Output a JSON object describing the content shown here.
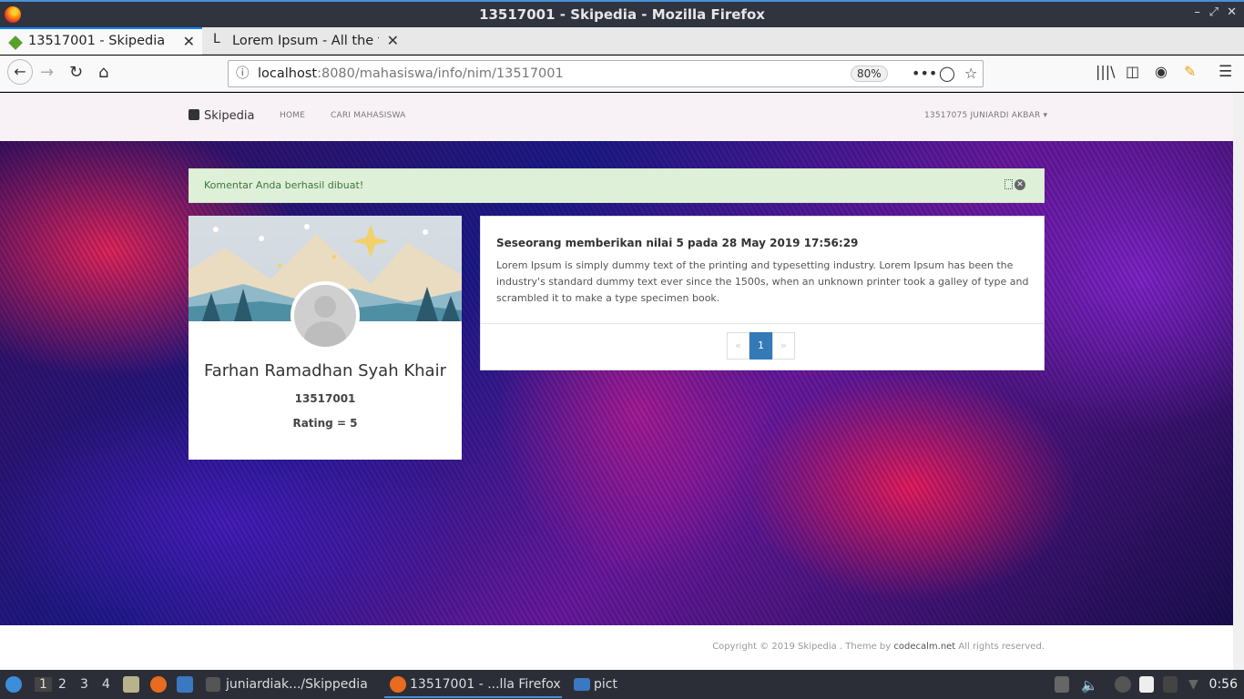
{
  "window": {
    "title": "13517001 - Skipedia - Mozilla Firefox"
  },
  "tabs": [
    {
      "label": "13517001 - Skipedia",
      "active": true
    },
    {
      "label": "Lorem Ipsum - All the facts - Lipsum generator",
      "active": false
    }
  ],
  "urlbar": {
    "host": "localhost",
    "path": ":8080/mahasiswa/info/nim/13517001",
    "zoom": "80%"
  },
  "site": {
    "brand": "Skipedia",
    "nav": [
      "HOME",
      "CARI MAHASISWA"
    ],
    "user": "13517075 JUNIARDI AKBAR"
  },
  "alert": {
    "text": "Komentar Anda berhasil dibuat!"
  },
  "profile": {
    "name": "Farhan Ramadhan Syah Khair",
    "nim": "13517001",
    "rating": "Rating = 5"
  },
  "review": {
    "title": "Seseorang memberikan nilai 5 pada 28 May 2019 17:56:29",
    "body": "Lorem Ipsum is simply dummy text of the printing and typesetting industry. Lorem Ipsum has been the industry's standard dummy text ever since the 1500s, when an unknown printer took a galley of type and scrambled it to make a type specimen book."
  },
  "pagination": {
    "prev": "«",
    "current": "1",
    "next": "»"
  },
  "footer": {
    "prefix": "Copyright © 2019 Skipedia . Theme by ",
    "link": "codecalm.net",
    "suffix": " All rights reserved."
  },
  "taskbar": {
    "workspaces": [
      "1",
      "2",
      "3",
      "4"
    ],
    "terminal": "juniardiak.../Skippedia",
    "firefox": "13517001 - ...lla Firefox",
    "folder": "pict",
    "clock": "0:56"
  }
}
